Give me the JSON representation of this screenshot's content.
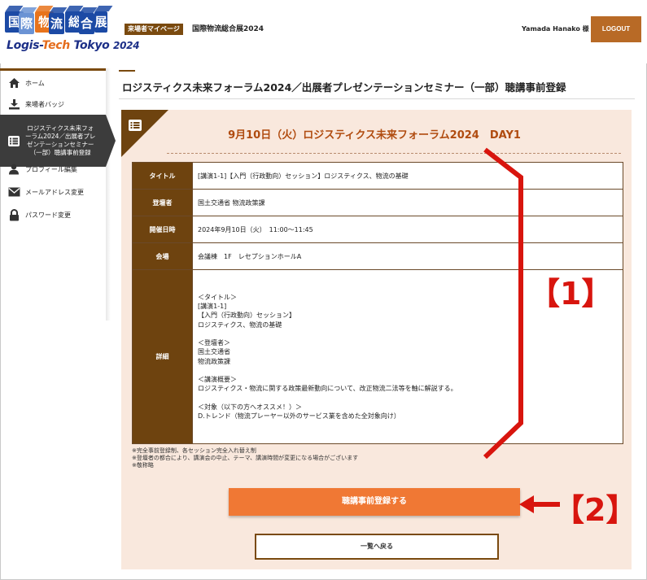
{
  "logo": {
    "chars": [
      "国",
      "際",
      "物",
      "流",
      "総",
      "合",
      "展"
    ],
    "sub_a": "Logis-",
    "sub_b": "Tech",
    "sub_c": " Tokyo ",
    "sub_year": "2024",
    "colors": [
      "#1c4aa5",
      "#6b93d4",
      "#e8731c",
      "#1c4aa5",
      "#1c4aa5",
      "#1c4aa5",
      "#1c4aa5"
    ]
  },
  "header": {
    "mypage_badge": "来場者マイページ",
    "event_name": "国際物流総合展2024",
    "user_name": "Yamada Hanako 様",
    "logout_label": "LOGOUT"
  },
  "sidebar": {
    "items": [
      {
        "label": "ホーム",
        "icon": "home-icon"
      },
      {
        "label": "来場者バッジ",
        "icon": "download-icon"
      },
      {
        "label": "ロジスティクス未来フォーラム2024／出展者プレゼンテーションセミナー（一部）聴講事前登録",
        "line1": "ロジスティクス未来フォ",
        "line2": "ーラム2024／出展者プレ",
        "line3": "ゼンテーションセミナー",
        "line4": "（一部）聴講事前登録",
        "icon": "list-icon"
      },
      {
        "label": "プロフィール編集",
        "icon": "user-icon"
      },
      {
        "label": "メールアドレス変更",
        "icon": "mail-icon"
      },
      {
        "label": "パスワード変更",
        "icon": "lock-icon"
      }
    ]
  },
  "main": {
    "page_title": "ロジスティクス未来フォーラム2024／出展者プレゼンテーションセミナー（一部）聴講事前登録",
    "day_title": "9月10日（火）ロジスティクス未来フォーラム2024　DAY1",
    "rows": [
      {
        "label": "タイトル",
        "value": "[講演1-1]【入門（行政動向）セッション】ロジスティクス、物流の基礎"
      },
      {
        "label": "登壇者",
        "value": "国土交通省 物流政策課"
      },
      {
        "label": "開催日時",
        "value": "2024年9月10日（火）　11:00〜11:45"
      },
      {
        "label": "会場",
        "value": "会議棟　1F　レセプションホールA"
      }
    ],
    "detail_label": "詳細",
    "detail": {
      "t_head": "＜タイトル＞",
      "t1": "[講演1-1]",
      "t2": "【入門（行政動向）セッション】",
      "t3": "ロジスティクス、物流の基礎",
      "s_head": "＜登壇者＞",
      "s1": "国土交通省",
      "s2": "物流政策課",
      "o_head": "＜講演概要＞",
      "o1": "ロジスティクス・物流に関する政策最新動向について、改正物流二法等を軸に解説する。",
      "a_head": "＜対象（以下の方へオススメ！）＞",
      "a1": "D.トレンド（物流プレーヤー以外のサービス業を含めた全対象向け）"
    },
    "notes": [
      "※完全事前登録制、各セッション完全入れ替え制",
      "※登壇者の都合により、講演会の中止、テーマ、講演時間が変更になる場合がございます",
      "※敬称略"
    ],
    "register_label": "聴講事前登録する",
    "back_label": "一覧へ戻る"
  },
  "annotations": {
    "label1": "【1】",
    "label2": "【2】",
    "color": "#d8150e"
  }
}
